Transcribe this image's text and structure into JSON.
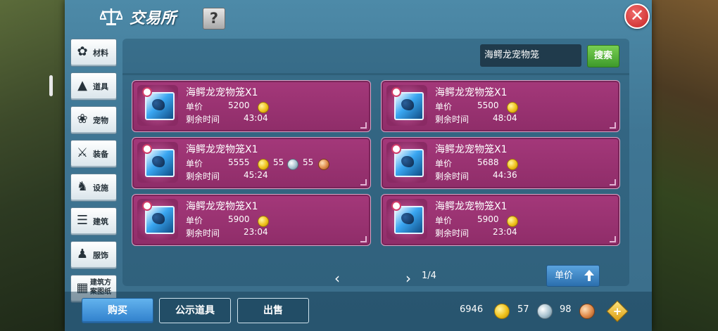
{
  "header": {
    "title": "交易所",
    "help_label": "?",
    "close_label": "✕"
  },
  "sidebar": {
    "items": [
      {
        "label": "材料",
        "icon": "materials-icon"
      },
      {
        "label": "道具",
        "icon": "item-icon"
      },
      {
        "label": "宠物",
        "icon": "paw-icon"
      },
      {
        "label": "装备",
        "icon": "equipment-icon"
      },
      {
        "label": "设施",
        "icon": "facility-icon"
      },
      {
        "label": "建筑",
        "icon": "building-icon"
      },
      {
        "label": "服饰",
        "icon": "clothing-icon"
      },
      {
        "label": "建筑方案图纸",
        "icon": "blueprint-icon"
      }
    ]
  },
  "search": {
    "value": "海鳄龙宠物笼",
    "button_label": "搜索"
  },
  "listing_labels": {
    "price": "单价",
    "time": "剩余时间"
  },
  "listings": [
    {
      "name": "海鳄龙宠物笼X1",
      "gold": "5200",
      "time": "43:04"
    },
    {
      "name": "海鳄龙宠物笼X1",
      "gold": "5500",
      "time": "48:04"
    },
    {
      "name": "海鳄龙宠物笼X1",
      "gold": "5555",
      "silver": "55",
      "copper": "55",
      "time": "45:24"
    },
    {
      "name": "海鳄龙宠物笼X1",
      "gold": "5688",
      "time": "44:36"
    },
    {
      "name": "海鳄龙宠物笼X1",
      "gold": "5900",
      "time": "23:04"
    },
    {
      "name": "海鳄龙宠物笼X1",
      "gold": "5900",
      "time": "23:04"
    }
  ],
  "pagination": {
    "text": "1/4",
    "prev": "‹",
    "next": "›"
  },
  "sort": {
    "label": "单价"
  },
  "actions": {
    "buy": "购买",
    "public": "公示道具",
    "sell": "出售"
  },
  "wallet": {
    "gold": "6946",
    "silver": "57",
    "copper": "98",
    "add_label": "+"
  },
  "colors": {
    "panel": "#3f7694",
    "card": "#9a3270",
    "buy_button": "#2f7fcb",
    "search_button": "#4fae37"
  }
}
